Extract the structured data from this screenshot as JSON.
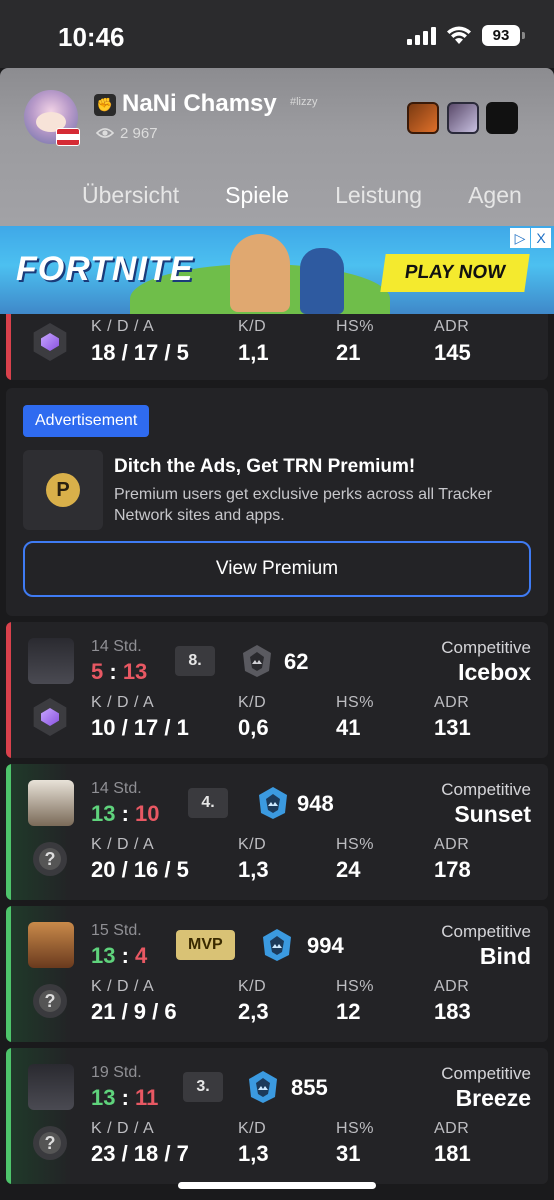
{
  "status": {
    "time": "10:46",
    "battery": "93"
  },
  "profile": {
    "name": "NaNi Chamsy",
    "tag": "#lizzy",
    "views": "2 967",
    "tabs": [
      "Übersicht",
      "Spiele",
      "Leistung",
      "Agen"
    ],
    "active_tab": "Spiele"
  },
  "ad_banner": {
    "brand": "FORTNITE",
    "cta": "PLAY NOW",
    "choices_icon": "ad-choices-icon",
    "close": "X"
  },
  "labels": {
    "kda": "K / D / A",
    "kd": "K/D",
    "hs": "HS%",
    "adr": "ADR"
  },
  "partial_match": {
    "kda": "18 / 17 / 5",
    "kd": "1,1",
    "hs": "21",
    "adr": "145"
  },
  "premium": {
    "badge": "Advertisement",
    "title": "Ditch the Ads, Get TRN Premium!",
    "description": "Premium users get exclusive perks across all Tracker Network sites and apps.",
    "button": "View Premium"
  },
  "matches": [
    {
      "result": "loss",
      "time": "14 Std.",
      "score_a": "5",
      "score_b": "13",
      "place": "8.",
      "rr": "62",
      "mode": "Competitive",
      "map": "Icebox",
      "kda": "10 / 17 / 1",
      "kd": "0,6",
      "hs": "41",
      "adr": "131"
    },
    {
      "result": "win",
      "time": "14 Std.",
      "score_a": "13",
      "score_b": "10",
      "place": "4.",
      "rr": "948",
      "mode": "Competitive",
      "map": "Sunset",
      "kda": "20 / 16 / 5",
      "kd": "1,3",
      "hs": "24",
      "adr": "178"
    },
    {
      "result": "win",
      "time": "15 Std.",
      "score_a": "13",
      "score_b": "4",
      "place": "MVP",
      "rr": "994",
      "mode": "Competitive",
      "map": "Bind",
      "kda": "21 / 9 / 6",
      "kd": "2,3",
      "hs": "12",
      "adr": "183"
    },
    {
      "result": "win",
      "time": "19 Std.",
      "score_a": "13",
      "score_b": "11",
      "place": "3.",
      "rr": "855",
      "mode": "Competitive",
      "map": "Breeze",
      "kda": "23 / 18 / 7",
      "kd": "1,3",
      "hs": "31",
      "adr": "181"
    }
  ],
  "colors": {
    "win": "#4ec46b",
    "loss": "#d9414c",
    "accent": "#2f6bf0",
    "mvp": "#d9c275"
  }
}
